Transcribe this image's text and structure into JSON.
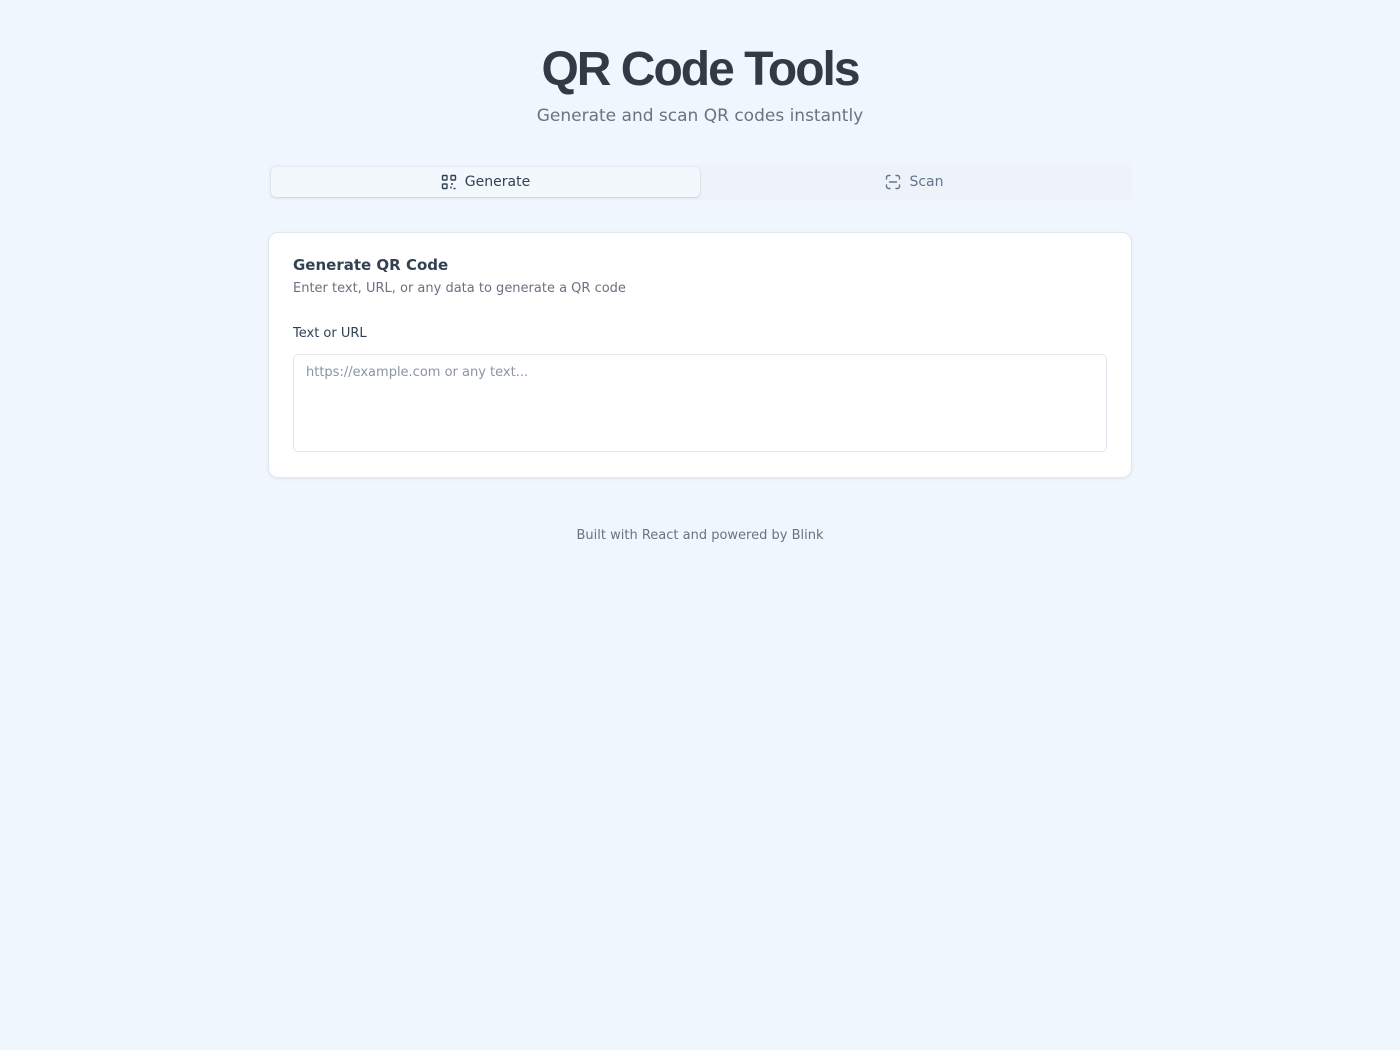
{
  "header": {
    "title": "QR Code Tools",
    "subtitle": "Generate and scan QR codes instantly"
  },
  "tabs": [
    {
      "label": "Generate",
      "icon": "qr-code-icon",
      "active": true
    },
    {
      "label": "Scan",
      "icon": "scan-icon",
      "active": false
    }
  ],
  "card": {
    "title": "Generate QR Code",
    "description": "Enter text, URL, or any data to generate a QR code",
    "field_label": "Text or URL",
    "input_value": "",
    "input_placeholder": "https://example.com or any text..."
  },
  "footer": {
    "text": "Built with React and powered by Blink"
  },
  "colors": {
    "background": "#eff6fd",
    "title": "#323a46",
    "muted_text": "#6b7280",
    "card_border": "#e2e8f0"
  }
}
